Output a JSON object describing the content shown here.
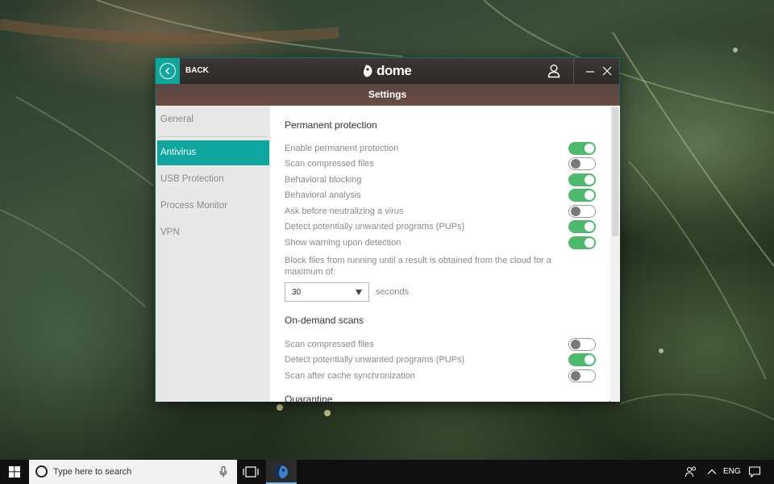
{
  "window": {
    "back_label": "BACK",
    "brand": "dome",
    "subtitle": "Settings",
    "accent_color": "#10a6a0",
    "toggle_on_color": "#4cba6a"
  },
  "sidebar": {
    "items": [
      {
        "label": "General",
        "active": false
      },
      {
        "label": "Antivirus",
        "active": true
      },
      {
        "label": "USB Protection",
        "active": false
      },
      {
        "label": "Process Monitor",
        "active": false
      },
      {
        "label": "VPN",
        "active": false
      }
    ]
  },
  "permanent": {
    "title": "Permanent protection",
    "options": [
      {
        "label": "Enable permanent protection",
        "state": "on"
      },
      {
        "label": "Scan compressed files",
        "state": "off"
      },
      {
        "label": "Behavioral blocking",
        "state": "on"
      },
      {
        "label": "Behavioral analysis",
        "state": "on"
      },
      {
        "label": "Ask before neutralizing a virus",
        "state": "off"
      },
      {
        "label": "Detect potentially unwanted programs (PUPs)",
        "state": "on"
      },
      {
        "label": "Show warning upon detection",
        "state": "on"
      }
    ],
    "cloud_desc": "Block files from running until a result is obtained from the cloud for a maximum of:",
    "cloud_value": "30",
    "cloud_unit": "seconds"
  },
  "ondemand": {
    "title": "On-demand scans",
    "options": [
      {
        "label": "Scan compressed files",
        "state": "off"
      },
      {
        "label": "Detect potentially unwanted programs (PUPs)",
        "state": "on"
      },
      {
        "label": "Scan after cache synchronization",
        "state": "off"
      }
    ]
  },
  "quarantine": {
    "title": "Quarantine"
  },
  "taskbar": {
    "search_placeholder": "Type here to search",
    "language": "ENG"
  }
}
